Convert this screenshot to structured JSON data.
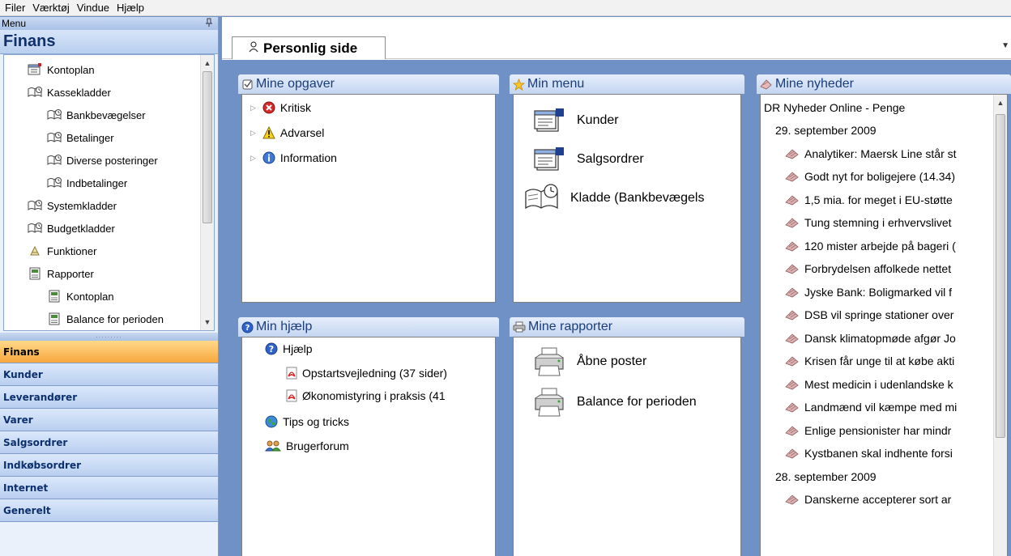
{
  "menubar": {
    "items": [
      "Filer",
      "Værktøj",
      "Vindue",
      "Hjælp"
    ]
  },
  "left": {
    "header_label": "Menu",
    "pin_icon": "pin-icon",
    "title": "Finans",
    "tree": [
      {
        "label": "Kontoplan",
        "icon": "chart-icon"
      },
      {
        "label": "Kassekladder",
        "icon": "journal-icon"
      },
      {
        "label": "Bankbevægelser",
        "icon": "journal-icon"
      },
      {
        "label": "Betalinger",
        "icon": "journal-icon"
      },
      {
        "label": "Diverse posteringer",
        "icon": "journal-icon"
      },
      {
        "label": "Indbetalinger",
        "icon": "journal-icon"
      },
      {
        "label": "Systemkladder",
        "icon": "journal-icon"
      },
      {
        "label": "Budgetkladder",
        "icon": "journal-icon"
      },
      {
        "label": "Funktioner",
        "icon": "function-icon"
      },
      {
        "label": "Rapporter",
        "icon": "report-icon"
      },
      {
        "label": "Kontoplan",
        "icon": "report-icon"
      },
      {
        "label": "Balance for perioden",
        "icon": "report-icon"
      }
    ],
    "nav": [
      "Finans",
      "Kunder",
      "Leverandører",
      "Varer",
      "Salgsordrer",
      "Indkøbsordrer",
      "Internet",
      "Generelt"
    ],
    "active_nav": "Finans"
  },
  "tab": {
    "label": "Personlig side",
    "icon": "user-icon"
  },
  "opgaver": {
    "title": "Mine opgaver",
    "items": [
      {
        "label": "Kritisk",
        "icon": "error-icon"
      },
      {
        "label": "Advarsel",
        "icon": "warning-icon"
      },
      {
        "label": "Information",
        "icon": "info-icon"
      }
    ]
  },
  "minmenu": {
    "title": "Min menu",
    "items": [
      {
        "label": "Kunder",
        "icon": "card-icon"
      },
      {
        "label": "Salgsordrer",
        "icon": "card-icon"
      },
      {
        "label": "Kladde (Bankbevægels",
        "icon": "journal-book-icon"
      }
    ]
  },
  "hjaelp": {
    "title": "Min hjælp",
    "items": [
      {
        "label": "Hjælp",
        "icon": "help-icon",
        "indent": 0
      },
      {
        "label": "Opstartsvejledning (37 sider)",
        "icon": "pdf-icon",
        "indent": 1
      },
      {
        "label": "Økonomistyring i praksis (41",
        "icon": "pdf-icon",
        "indent": 1
      },
      {
        "label": "Tips og tricks",
        "icon": "globe-icon",
        "indent": 0
      },
      {
        "label": "Brugerforum",
        "icon": "users-icon",
        "indent": 0
      }
    ]
  },
  "rapporter": {
    "title": "Mine rapporter",
    "items": [
      {
        "label": "Åbne poster",
        "icon": "printer-icon"
      },
      {
        "label": "Balance for perioden",
        "icon": "printer-icon"
      }
    ]
  },
  "nyheder": {
    "title": "Mine nyheder",
    "source": "DR Nyheder Online - Penge",
    "rows": [
      {
        "type": "date",
        "label": "29. september 2009"
      },
      {
        "type": "item",
        "label": "Analytiker: Maersk Line står st"
      },
      {
        "type": "item",
        "label": "Godt nyt for boligejere (14.34)"
      },
      {
        "type": "item",
        "label": "1,5 mia. for meget i EU-støtte"
      },
      {
        "type": "item",
        "label": "Tung stemning i erhvervslivet"
      },
      {
        "type": "item",
        "label": "120 mister arbejde på bageri ("
      },
      {
        "type": "item",
        "label": "Forbrydelsen affolkede nettet"
      },
      {
        "type": "item",
        "label": "Jyske Bank: Boligmarked vil f"
      },
      {
        "type": "item",
        "label": "DSB vil springe stationer over"
      },
      {
        "type": "item",
        "label": "Dansk klimatopmøde afgør Jo"
      },
      {
        "type": "item",
        "label": "Krisen får unge til at købe akti"
      },
      {
        "type": "item",
        "label": "Mest medicin i udenlandske k"
      },
      {
        "type": "item",
        "label": "Landmænd vil kæmpe med mi"
      },
      {
        "type": "item",
        "label": "Enlige pensionister har mindr"
      },
      {
        "type": "item",
        "label": "Kystbanen skal indhente forsi"
      },
      {
        "type": "date",
        "label": "28. september 2009"
      },
      {
        "type": "item",
        "label": "Danskerne accepterer sort ar"
      }
    ]
  },
  "colors": {
    "accent": "#f7a73d",
    "nav_text": "#0c2f6e",
    "panel_title": "#1a3d7a",
    "background": "#6f91c6"
  }
}
